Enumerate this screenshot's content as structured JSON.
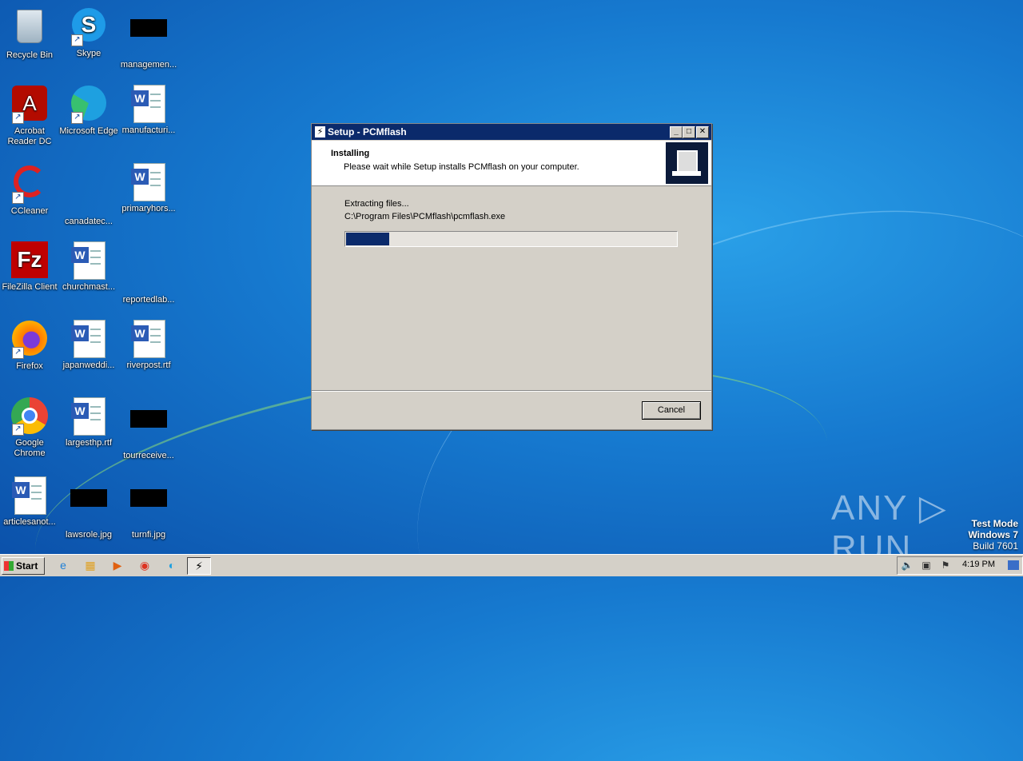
{
  "desktop": {
    "icons": [
      {
        "label": "Recycle Bin"
      },
      {
        "label": "Skype"
      },
      {
        "label": "managemen..."
      },
      {
        "label": "Acrobat Reader DC"
      },
      {
        "label": "Microsoft Edge"
      },
      {
        "label": "manufacturi..."
      },
      {
        "label": "CCleaner"
      },
      {
        "label": "canadatec..."
      },
      {
        "label": "primaryhors..."
      },
      {
        "label": "FileZilla Client"
      },
      {
        "label": "churchmast..."
      },
      {
        "label": "reportedlab..."
      },
      {
        "label": "Firefox"
      },
      {
        "label": "japanweddi..."
      },
      {
        "label": "riverpost.rtf"
      },
      {
        "label": "Google Chrome"
      },
      {
        "label": "largesthp.rtf"
      },
      {
        "label": "tourreceive..."
      },
      {
        "label": "articlesanot..."
      },
      {
        "label": "lawsrole.jpg"
      },
      {
        "label": "turnfi.jpg"
      }
    ]
  },
  "dialog": {
    "title": "Setup - PCMflash",
    "header_title": "Installing",
    "header_subtitle": "Please wait while Setup installs PCMflash on your computer.",
    "status_line": "Extracting files...",
    "file_path": "C:\\Program Files\\PCMflash\\pcmflash.exe",
    "progress_fraction": 0.13,
    "cancel_label": "Cancel",
    "min_glyph": "_",
    "max_glyph": "□",
    "close_glyph": "✕"
  },
  "watermark": {
    "brand": "ANY ▷ RUN",
    "line1": "Test Mode",
    "line2": "Windows 7",
    "line3": "Build 7601"
  },
  "taskbar": {
    "start_label": "Start",
    "clock": "4:19 PM",
    "apps": [
      "ie-icon",
      "explorer-icon",
      "media-player-icon",
      "chrome-icon",
      "edge-icon",
      "pcmflash-icon"
    ]
  }
}
